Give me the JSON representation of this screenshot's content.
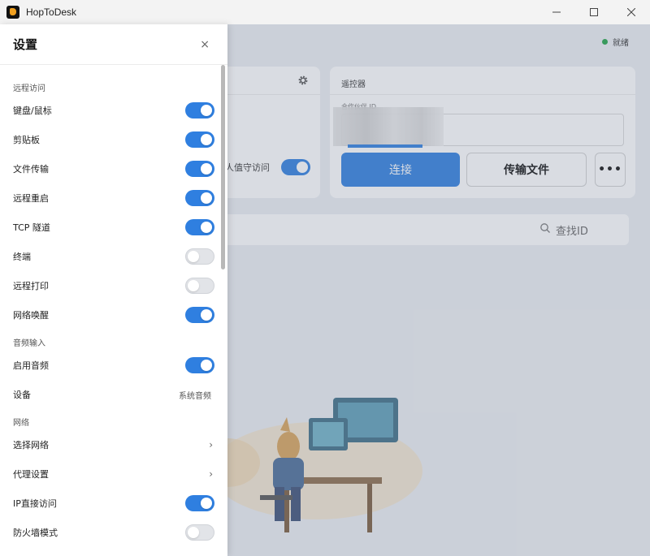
{
  "window": {
    "title": "HopToDesk",
    "controls": [
      "minimize",
      "maximize",
      "close"
    ]
  },
  "background": {
    "status_text": "就绪",
    "left_card_settings_icon": "gear-icon",
    "unattended_label": "无人值守访问",
    "remote_card_title": "遥控器",
    "partner_id_label": "合作伙伴 ID",
    "connect_label": "连接",
    "transfer_label": "传输文件",
    "more_label": "•••",
    "search_placeholder": "查找ID"
  },
  "settings": {
    "title": "设置",
    "close_label": "×",
    "sections": [
      {
        "title": "远程访问",
        "rows": [
          {
            "label": "键盘/鼠标",
            "type": "toggle",
            "on": true
          },
          {
            "label": "剪贴板",
            "type": "toggle",
            "on": true
          },
          {
            "label": "文件传输",
            "type": "toggle",
            "on": true
          },
          {
            "label": "远程重启",
            "type": "toggle",
            "on": true
          },
          {
            "label": "TCP 隧道",
            "type": "toggle",
            "on": true
          },
          {
            "label": "终端",
            "type": "toggle",
            "on": false
          },
          {
            "label": "远程打印",
            "type": "toggle",
            "on": false
          },
          {
            "label": "网络唤醒",
            "type": "toggle",
            "on": true
          }
        ]
      },
      {
        "title": "音频输入",
        "rows": [
          {
            "label": "启用音频",
            "type": "toggle",
            "on": true
          },
          {
            "label": "设备",
            "type": "value",
            "value": "系统音频"
          }
        ]
      },
      {
        "title": "网络",
        "rows": [
          {
            "label": "选择网络",
            "type": "link",
            "chevron": "›"
          },
          {
            "label": "代理设置",
            "type": "link",
            "chevron": "›"
          },
          {
            "label": "IP直接访问",
            "type": "toggle",
            "on": true
          },
          {
            "label": "防火墙模式",
            "type": "toggle",
            "on": false
          }
        ]
      }
    ]
  },
  "colors": {
    "accent": "#2f7fe0",
    "status_ok": "#22a447"
  }
}
